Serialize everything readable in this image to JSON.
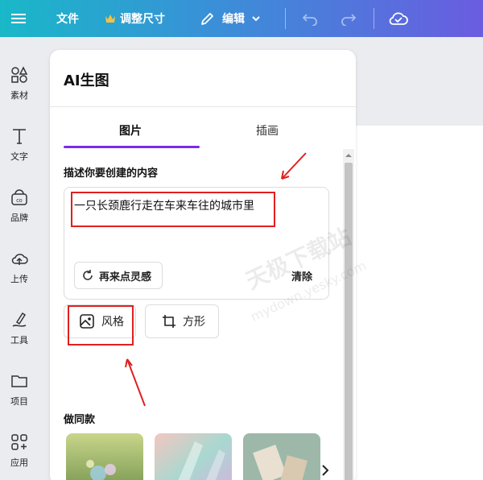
{
  "topbar": {
    "file_label": "文件",
    "resize_label": "调整尺寸",
    "edit_label": "编辑"
  },
  "rail": {
    "items": [
      {
        "label": "素材",
        "icon": "elements-icon"
      },
      {
        "label": "文字",
        "icon": "text-icon"
      },
      {
        "label": "品牌",
        "icon": "brand-icon"
      },
      {
        "label": "上传",
        "icon": "upload-icon"
      },
      {
        "label": "工具",
        "icon": "draw-icon"
      },
      {
        "label": "项目",
        "icon": "folder-icon"
      },
      {
        "label": "应用",
        "icon": "apps-icon"
      }
    ]
  },
  "panel": {
    "title": "AI生图",
    "tabs": [
      {
        "label": "图片",
        "active": true
      },
      {
        "label": "插画",
        "active": false
      }
    ],
    "describe_label": "描述你要创建的内容",
    "prompt_value": "一只长颈鹿行走在车来车往的城市里",
    "inspire_label": "再来点灵感",
    "clear_label": "清除",
    "style_label": "风格",
    "shape_label": "方形",
    "same_style_label": "做同款"
  },
  "watermark": {
    "line1": "天极下载站",
    "line2": "mydown.yesky.com"
  },
  "colors": {
    "accent": "#7d2ae8",
    "annotation": "#e02020"
  }
}
